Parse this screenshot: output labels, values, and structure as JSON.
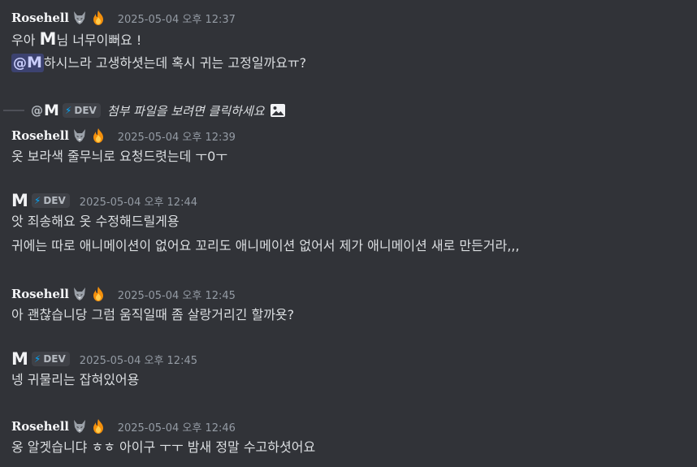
{
  "messages": [
    {
      "author": "Rosehell",
      "timestamp": "2025-05-04 오후 12:37",
      "lines": [
        {
          "pre": "우아 ",
          "m": "M",
          "post": "님 너무이뻐요 !"
        },
        {
          "mention_at": "@",
          "mention_m": "M",
          "post": "하시느라 고생하셧는데 혹시 귀는 고정일까요ㅠ?"
        }
      ]
    },
    {
      "reply": {
        "at": "@",
        "m": "M",
        "badge": "DEV",
        "text": "첨부 파일을 보려면 클릭하세요"
      },
      "author": "Rosehell",
      "timestamp": "2025-05-04 오후 12:39",
      "lines": [
        "옷 보라색 줄무늬로 요청드렷는데 ㅜ0ㅜ"
      ]
    },
    {
      "author": "M",
      "badge": "DEV",
      "timestamp": "2025-05-04 오후 12:44",
      "lines": [
        "앗 죄송해요 옷 수정해드릴게용",
        "귀에는 따로 애니메이션이 없어요 꼬리도 애니메이션 없어서 제가 애니메이션 새로 만든거라,,,"
      ]
    },
    {
      "author": "Rosehell",
      "timestamp": "2025-05-04 오후 12:45",
      "lines": [
        "아 괜찮습니당 그럼 움직일때 좀 살랑거리긴 할까욧?"
      ]
    },
    {
      "author": "M",
      "badge": "DEV",
      "timestamp": "2025-05-04 오후 12:45",
      "lines": [
        "넹 귀물리는 잡혀있어용"
      ]
    },
    {
      "author": "Rosehell",
      "timestamp": "2025-05-04 오후 12:46",
      "lines": [
        "옹 알겟습니댜 ㅎㅎ 아이구 ㅜㅜ 밤새 정말 수고하셧어요"
      ]
    }
  ],
  "icons": {
    "wolf": "wolf-emoji-icon",
    "fire": "fire-emoji-icon",
    "bolt": "lightning-icon",
    "image": "image-icon"
  },
  "colors": {
    "background": "#313338",
    "text": "#dbdee1",
    "muted": "#949ba4",
    "mention_bg": "#3c4270",
    "bolt": "#00a8fc"
  }
}
